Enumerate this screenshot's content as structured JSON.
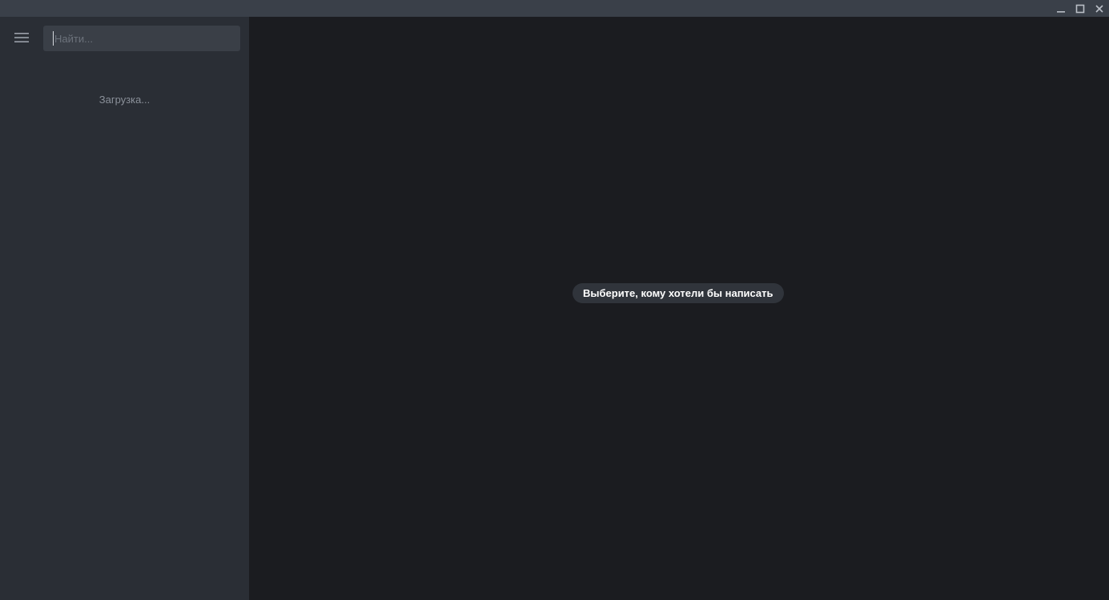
{
  "window": {
    "controls": {
      "minimize_icon": "minimize-icon",
      "maximize_icon": "maximize-icon",
      "close_icon": "close-icon"
    }
  },
  "sidebar": {
    "menu_icon": "hamburger-menu-icon",
    "search": {
      "placeholder": "Найти...",
      "value": ""
    },
    "loading_text": "Загрузка..."
  },
  "main": {
    "empty_state_text": "Выберите, кому хотели бы написать"
  },
  "colors": {
    "titlebar": "#3a4049",
    "sidebar": "#2a2e35",
    "search_bg": "#3a3f47",
    "main_bg": "#1b1c20",
    "pill_bg": "#30343b",
    "text_primary": "#ffffff",
    "text_muted": "#8a9099"
  }
}
